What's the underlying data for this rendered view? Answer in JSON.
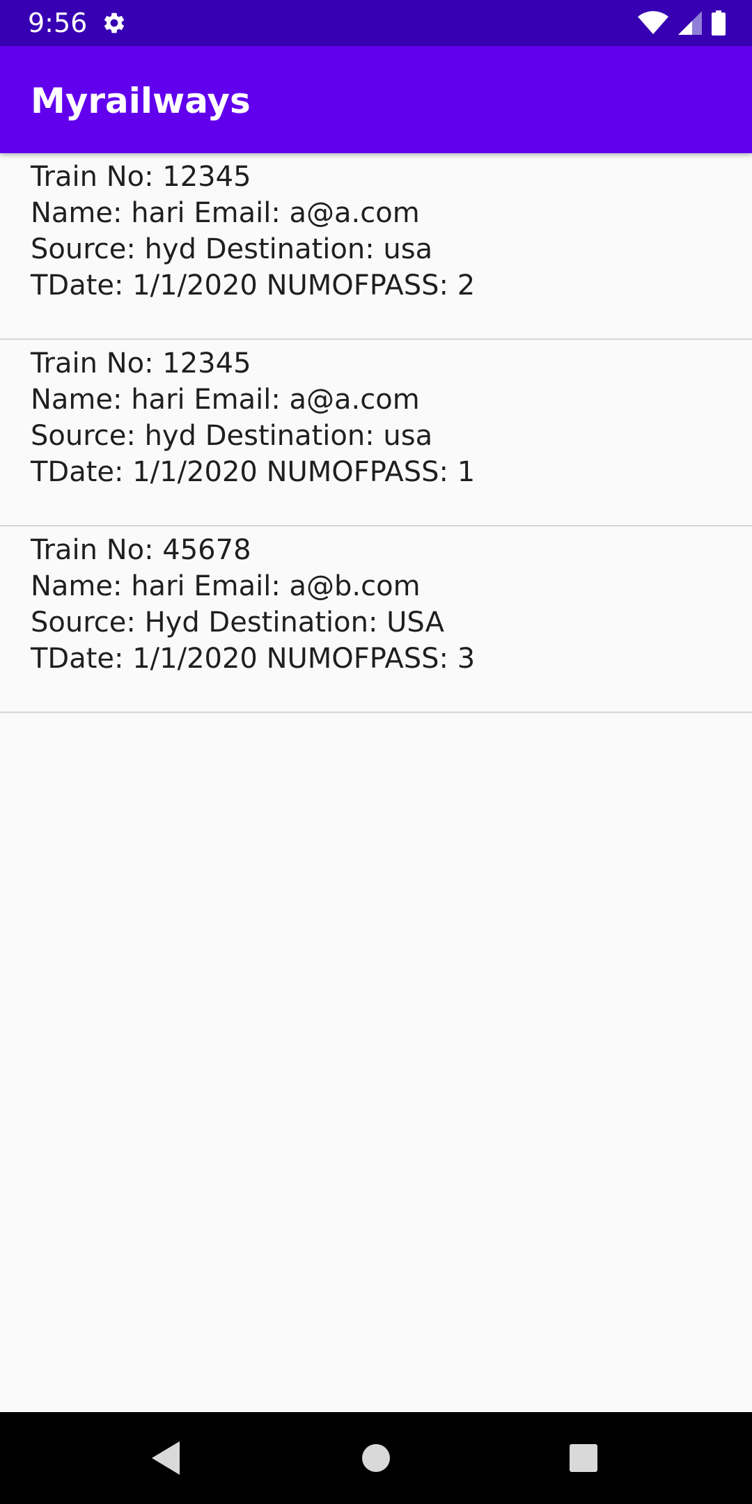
{
  "status_bar": {
    "time": "9:56",
    "icons": [
      "gear-icon",
      "wifi-icon",
      "signal-icon",
      "battery-icon"
    ],
    "background": "#3700b3"
  },
  "app_bar": {
    "title": "Myrailways",
    "background": "#6200ee"
  },
  "bookings": [
    {
      "train_line": "Train No: 12345",
      "name_line": "Name: hari Email: a@a.com",
      "route_line": "Source: hyd Destination: usa",
      "date_line": "TDate: 1/1/2020 NUMOFPASS: 2"
    },
    {
      "train_line": "Train No: 12345",
      "name_line": "Name: hari Email: a@a.com",
      "route_line": "Source: hyd Destination: usa",
      "date_line": "TDate: 1/1/2020 NUMOFPASS: 1"
    },
    {
      "train_line": "Train No: 45678",
      "name_line": "Name: hari Email: a@b.com",
      "route_line": "Source: Hyd Destination: USA",
      "date_line": "TDate: 1/1/2020 NUMOFPASS: 3"
    }
  ],
  "nav_bar": {
    "icons": [
      "back-icon",
      "home-icon",
      "recents-icon"
    ]
  }
}
